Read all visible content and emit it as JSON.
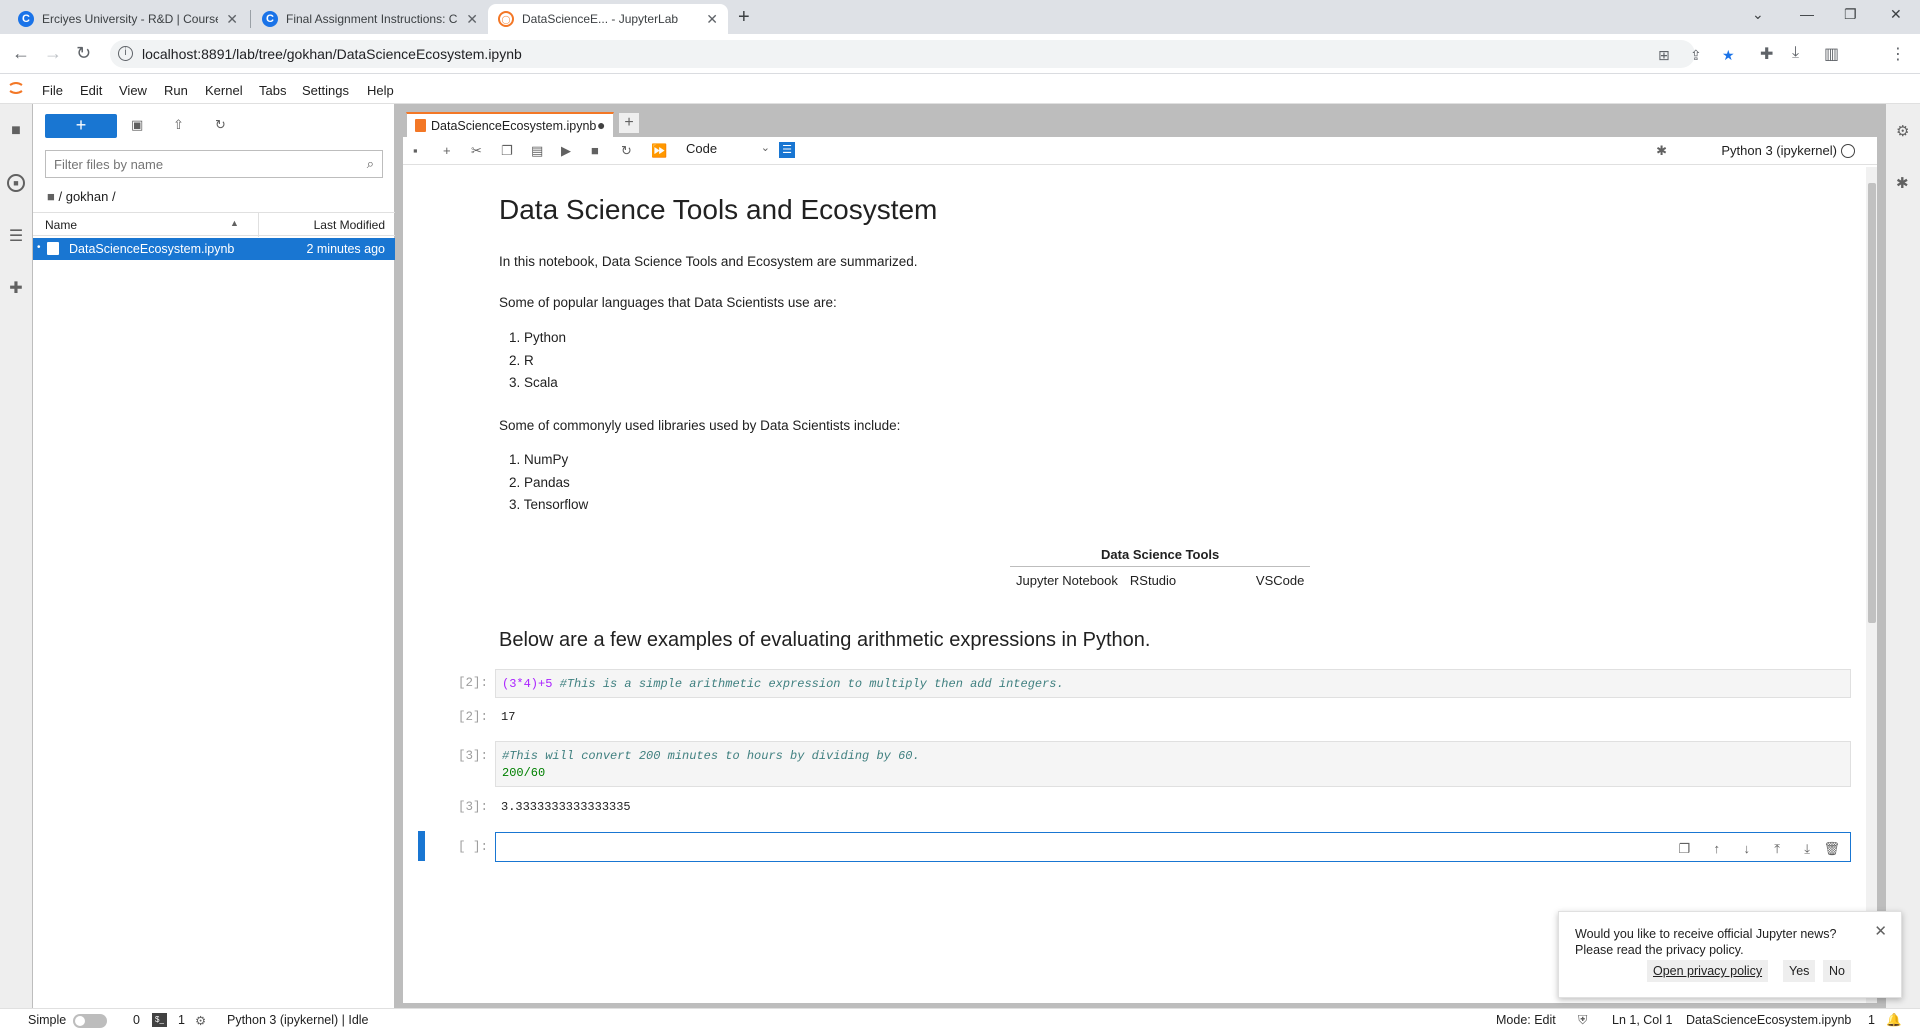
{
  "browser": {
    "tabs": [
      {
        "title": "Erciyes University - R&D | Course",
        "favicon": "C"
      },
      {
        "title": "Final Assignment Instructions: Cr",
        "favicon": "C"
      },
      {
        "title": "DataScienceE... - JupyterLab",
        "favicon": "jupyter"
      }
    ],
    "url": "localhost:8891/lab/tree/gokhan/DataScienceEcosystem.ipynb"
  },
  "menu": [
    "File",
    "Edit",
    "View",
    "Run",
    "Kernel",
    "Tabs",
    "Settings",
    "Help"
  ],
  "filebrowser": {
    "filter_placeholder": "Filter files by name",
    "breadcrumb": "/ gokhan /",
    "col_name": "Name",
    "col_modified": "Last Modified",
    "file": {
      "name": "DataScienceEcosystem.ipynb",
      "modified": "2 minutes ago"
    }
  },
  "notebook": {
    "tab_title": "DataScienceEcosystem.ipynb",
    "cell_type": "Code",
    "kernel": "Python 3 (ipykernel)",
    "title": "Data Science Tools and Ecosystem",
    "intro": "In this notebook, Data Science Tools and Ecosystem are summarized.",
    "languages_heading": "Some of popular languages that Data Scientists use are:",
    "languages": [
      "1. Python",
      "2. R",
      "3. Scala"
    ],
    "libraries_heading": "Some of commonyly used libraries used by Data Scientists include:",
    "libraries": [
      "1. NumPy",
      "2. Pandas",
      "3. Tensorflow"
    ],
    "table": {
      "header": "Data Science Tools",
      "row": [
        "Jupyter Notebook",
        "RStudio",
        "VSCode"
      ]
    },
    "examples_heading": "Below are a few examples of evaluating arithmetic expressions in Python.",
    "cells": [
      {
        "prompt": "[2]:",
        "code_expr": "(3*4)+5",
        "code_comment": "#This is a simple arithmetic expression to multiply then add integers.",
        "out_prompt": "[2]:",
        "output": "17"
      },
      {
        "prompt": "[3]:",
        "code_comment": "#This will convert 200 minutes to hours by dividing by 60.",
        "code_expr": "200/60",
        "out_prompt": "[3]:",
        "output": "3.3333333333333335"
      }
    ],
    "empty_prompt": "[ ]:"
  },
  "toast": {
    "message": "Would you like to receive official Jupyter news? Please read the privacy policy.",
    "link": "Open privacy policy",
    "yes": "Yes",
    "no": "No"
  },
  "status": {
    "mode_label": "Simple",
    "terminals": "0",
    "kernels": "1",
    "kernel_status": "Python 3 (ipykernel) | Idle",
    "mode": "Mode: Edit",
    "position": "Ln 1, Col 1",
    "filename": "DataScienceEcosystem.ipynb",
    "notifications": "1"
  },
  "colors": {
    "accent": "#1976d2",
    "jupyter_orange": "#f37726"
  }
}
